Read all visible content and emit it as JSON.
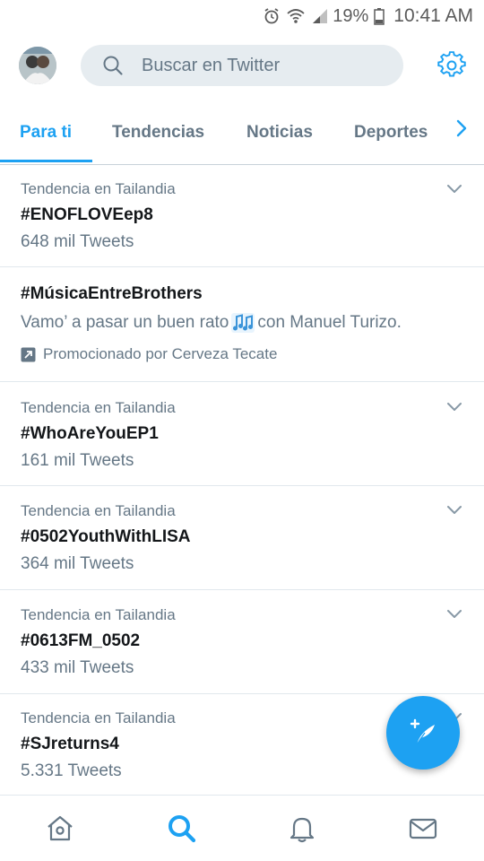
{
  "status_bar": {
    "battery_percent": "19%",
    "time": "10:41 AM",
    "icons": [
      "alarm-icon",
      "wifi-icon",
      "signal-icon",
      "battery-icon"
    ]
  },
  "header": {
    "search_placeholder": "Buscar en Twitter",
    "icons": [
      "avatar",
      "search-icon",
      "gear-icon"
    ]
  },
  "tabs": [
    {
      "label": "Para ti",
      "active": true
    },
    {
      "label": "Tendencias",
      "active": false
    },
    {
      "label": "Noticias",
      "active": false
    },
    {
      "label": "Deportes",
      "active": false
    }
  ],
  "trends": [
    {
      "context": "Tendencia en Tailandia",
      "tag": "#ENOFLOVEep8",
      "count": "648 mil Tweets"
    },
    {
      "tag": "#MúsicaEntreBrothers",
      "description": "Vamo’ a pasar un buen rato",
      "description_tail": "con Manuel Turizo.",
      "promoted": "Promocionado por Cerveza Tecate"
    },
    {
      "context": "Tendencia en Tailandia",
      "tag": "#WhoAreYouEP1",
      "count": "161 mil Tweets"
    },
    {
      "context": "Tendencia en Tailandia",
      "tag": "#0502YouthWithLISA",
      "count": "364 mil Tweets"
    },
    {
      "context": "Tendencia en Tailandia",
      "tag": "#0613FM_0502",
      "count": "433 mil Tweets"
    },
    {
      "context": "Tendencia en Tailandia",
      "tag": "#SJreturns4",
      "count": "5.331 Tweets"
    }
  ],
  "bottom_nav": [
    "home-icon",
    "search-icon",
    "notifications-icon",
    "messages-icon"
  ],
  "colors": {
    "accent": "#1da1f2",
    "muted": "#657786",
    "text": "#14171a"
  }
}
